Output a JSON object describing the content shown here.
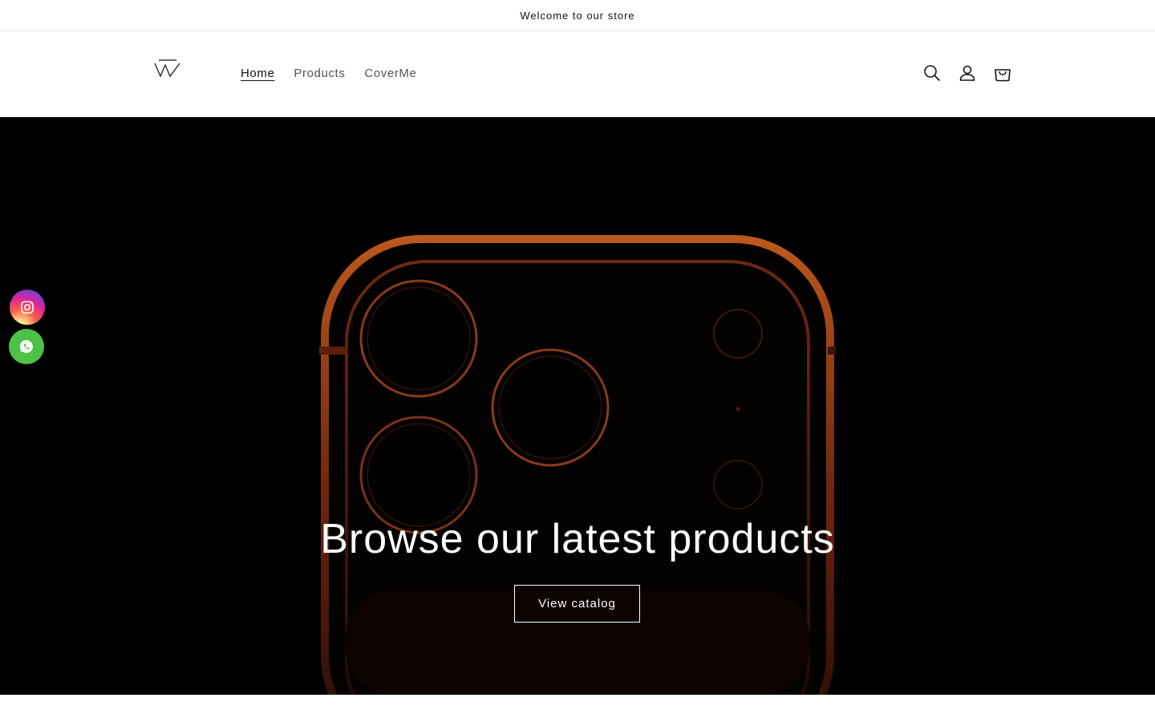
{
  "announcement": {
    "text": "Welcome to our store"
  },
  "header": {
    "logo_name": "store-logo",
    "nav": {
      "home": "Home",
      "products": "Products",
      "coverme": "CoverMe"
    },
    "icons": [
      "search-icon",
      "account-icon",
      "cart-icon"
    ]
  },
  "hero": {
    "title": "Browse our latest products",
    "button_label": "View catalog",
    "background_color": "#000000",
    "accent_glow": "#c0501f"
  },
  "social": {
    "instagram_color": "#d6249f",
    "whatsapp_color": "#4dc247"
  }
}
